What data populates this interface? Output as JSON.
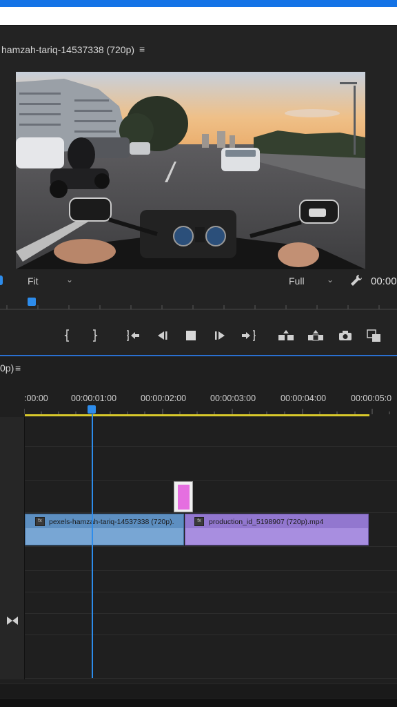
{
  "program_monitor": {
    "title": "hamzah-tariq-14537338 (720p)",
    "menu_icon": "≡",
    "fit_label": "Fit",
    "resolution_label": "Full",
    "timecode": "00:00",
    "chevron": "⌄"
  },
  "transport": {
    "icons": [
      "mark-in-icon",
      "mark-out-icon",
      "go-to-in-icon",
      "step-back-icon",
      "stop-icon",
      "step-forward-icon",
      "go-to-out-icon",
      "insert-icon",
      "overwrite-icon",
      "camera-icon",
      "compare-icon"
    ]
  },
  "timeline": {
    "title": "0p)",
    "menu_icon": "≡",
    "ruler_labels": [
      ":00:00",
      "00:00:01:00",
      "00:00:02:00",
      "00:00:03:00",
      "00:00:04:00",
      "00:00:05:0"
    ],
    "clips": [
      {
        "name": "pexels-hamzah-tariq-14537338 (720p).",
        "color": "#78a6d4"
      },
      {
        "name": "production_id_5198907 (720p).mp4",
        "color": "#a88ee0"
      }
    ],
    "graphic_color": "#e56fe0",
    "playhead_color": "#2d8ceb",
    "work_area_color": "#d9c92b"
  }
}
